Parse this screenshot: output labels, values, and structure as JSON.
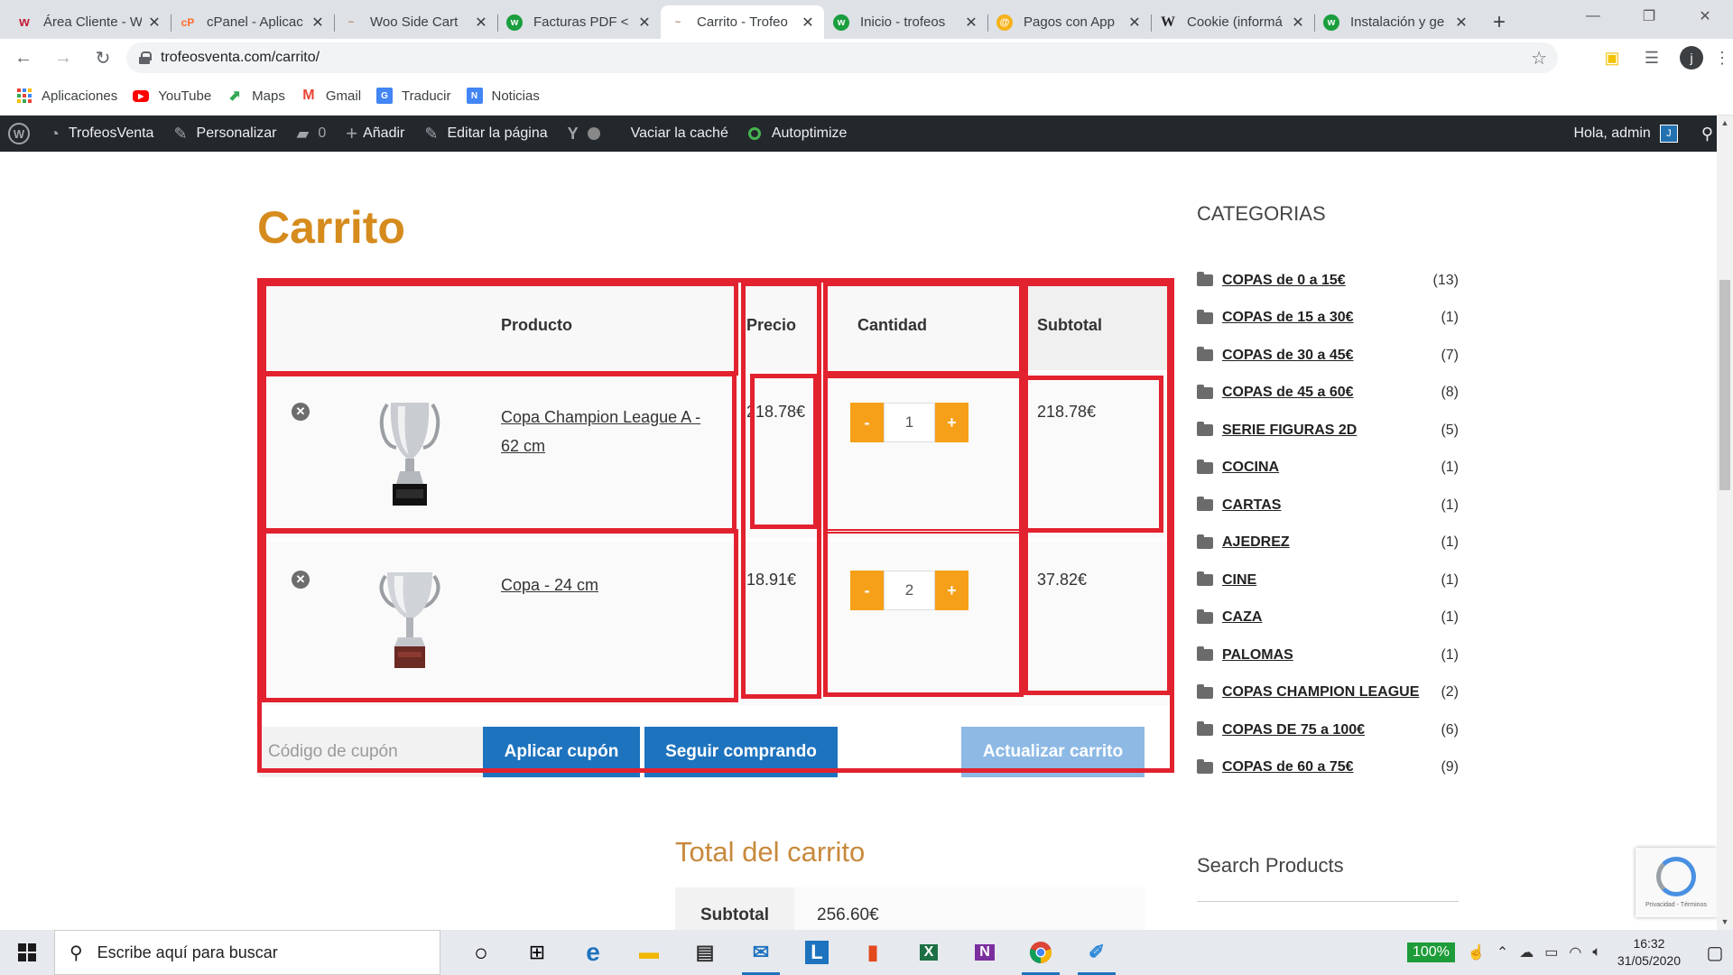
{
  "browser": {
    "tabs": [
      {
        "title": "Área Cliente - W",
        "favicon": "w",
        "favicon_color": "#c41e3a",
        "active": false
      },
      {
        "title": "cPanel - Aplicac",
        "favicon": "cP",
        "favicon_color": "#ff6c2c",
        "active": false
      },
      {
        "title": "Woo Side Cart",
        "favicon": "~",
        "favicon_color": "#b38a6b",
        "active": false
      },
      {
        "title": "Facturas PDF <",
        "favicon": "w",
        "favicon_color": "#1b9e3e",
        "active": false
      },
      {
        "title": "Carrito - Trofeo",
        "favicon": "~",
        "favicon_color": "#b38a6b",
        "active": true
      },
      {
        "title": "Inicio - trofeos",
        "favicon": "w",
        "favicon_color": "#1b9e3e",
        "active": false
      },
      {
        "title": "Pagos con App",
        "favicon": "@",
        "favicon_color": "#f6b21a",
        "active": false
      },
      {
        "title": "Cookie (informá",
        "favicon": "W",
        "favicon_color": "#ffffff",
        "active": false
      },
      {
        "title": "Instalación y ge",
        "favicon": "w",
        "favicon_color": "#1b9e3e",
        "active": false
      }
    ],
    "url": "trofeosventa.com/carrito/",
    "bookmarks": [
      {
        "label": "Aplicaciones",
        "icon": "apps-grid-icon"
      },
      {
        "label": "YouTube",
        "icon": "youtube-icon"
      },
      {
        "label": "Maps",
        "icon": "maps-icon"
      },
      {
        "label": "Gmail",
        "icon": "gmail-icon"
      },
      {
        "label": "Traducir",
        "icon": "translate-icon"
      },
      {
        "label": "Noticias",
        "icon": "news-icon"
      }
    ],
    "profile_initial": "j"
  },
  "adminbar": {
    "site": "TrofeosVenta",
    "customize": "Personalizar",
    "comments": "0",
    "new": "Añadir",
    "edit": "Editar la página",
    "cache": "Vaciar la caché",
    "autoptimize": "Autoptimize",
    "greeting": "Hola, admin",
    "avatar": "J"
  },
  "page": {
    "title": "Carrito",
    "cart": {
      "headers": {
        "product": "Producto",
        "price": "Precio",
        "quantity": "Cantidad",
        "subtotal": "Subtotal"
      },
      "items": [
        {
          "name": "Copa Champion League A - 62 cm",
          "price": "218.78€",
          "qty": "1",
          "subtotal": "218.78€"
        },
        {
          "name": "Copa - 24 cm",
          "price": "18.91€",
          "qty": "2",
          "subtotal": "37.82€"
        }
      ],
      "minus": "-",
      "plus": "+",
      "coupon_placeholder": "Código de cupón",
      "apply_coupon": "Aplicar cupón",
      "continue_shopping": "Seguir comprando",
      "update_cart": "Actualizar carrito"
    },
    "totals": {
      "title": "Total del carrito",
      "subtotal_label": "Subtotal",
      "subtotal_value": "256.60€"
    }
  },
  "sidebar": {
    "categories_title": "CATEGORIAS",
    "categories": [
      {
        "name": "COPAS de 0 a 15€",
        "count": "(13)"
      },
      {
        "name": "COPAS de 15 a 30€",
        "count": "(1)"
      },
      {
        "name": "COPAS de 30 a 45€",
        "count": "(7)"
      },
      {
        "name": "COPAS de 45 a 60€",
        "count": "(8)"
      },
      {
        "name": "SERIE FIGURAS 2D",
        "count": "(5)"
      },
      {
        "name": "COCINA",
        "count": "(1)"
      },
      {
        "name": "CARTAS",
        "count": "(1)"
      },
      {
        "name": "AJEDREZ",
        "count": "(1)"
      },
      {
        "name": "CINE",
        "count": "(1)"
      },
      {
        "name": "CAZA",
        "count": "(1)"
      },
      {
        "name": "PALOMAS",
        "count": "(1)"
      },
      {
        "name": "COPAS CHAMPION LEAGUE",
        "count": "(2)"
      },
      {
        "name": "COPAS DE 75 a 100€",
        "count": "(6)"
      },
      {
        "name": "COPAS de 60 a 75€",
        "count": "(9)"
      }
    ],
    "search_title": "Search Products",
    "recaptcha_text": "Privacidad - Términos"
  },
  "taskbar": {
    "search_placeholder": "Escribe aquí para buscar",
    "battery": "100%",
    "time": "16:32",
    "date": "31/05/2020"
  },
  "colors": {
    "title_orange": "#d68b1d",
    "button_blue": "#1e73be",
    "qty_orange": "#f6a01a",
    "annotation_red": "#e2222f"
  }
}
